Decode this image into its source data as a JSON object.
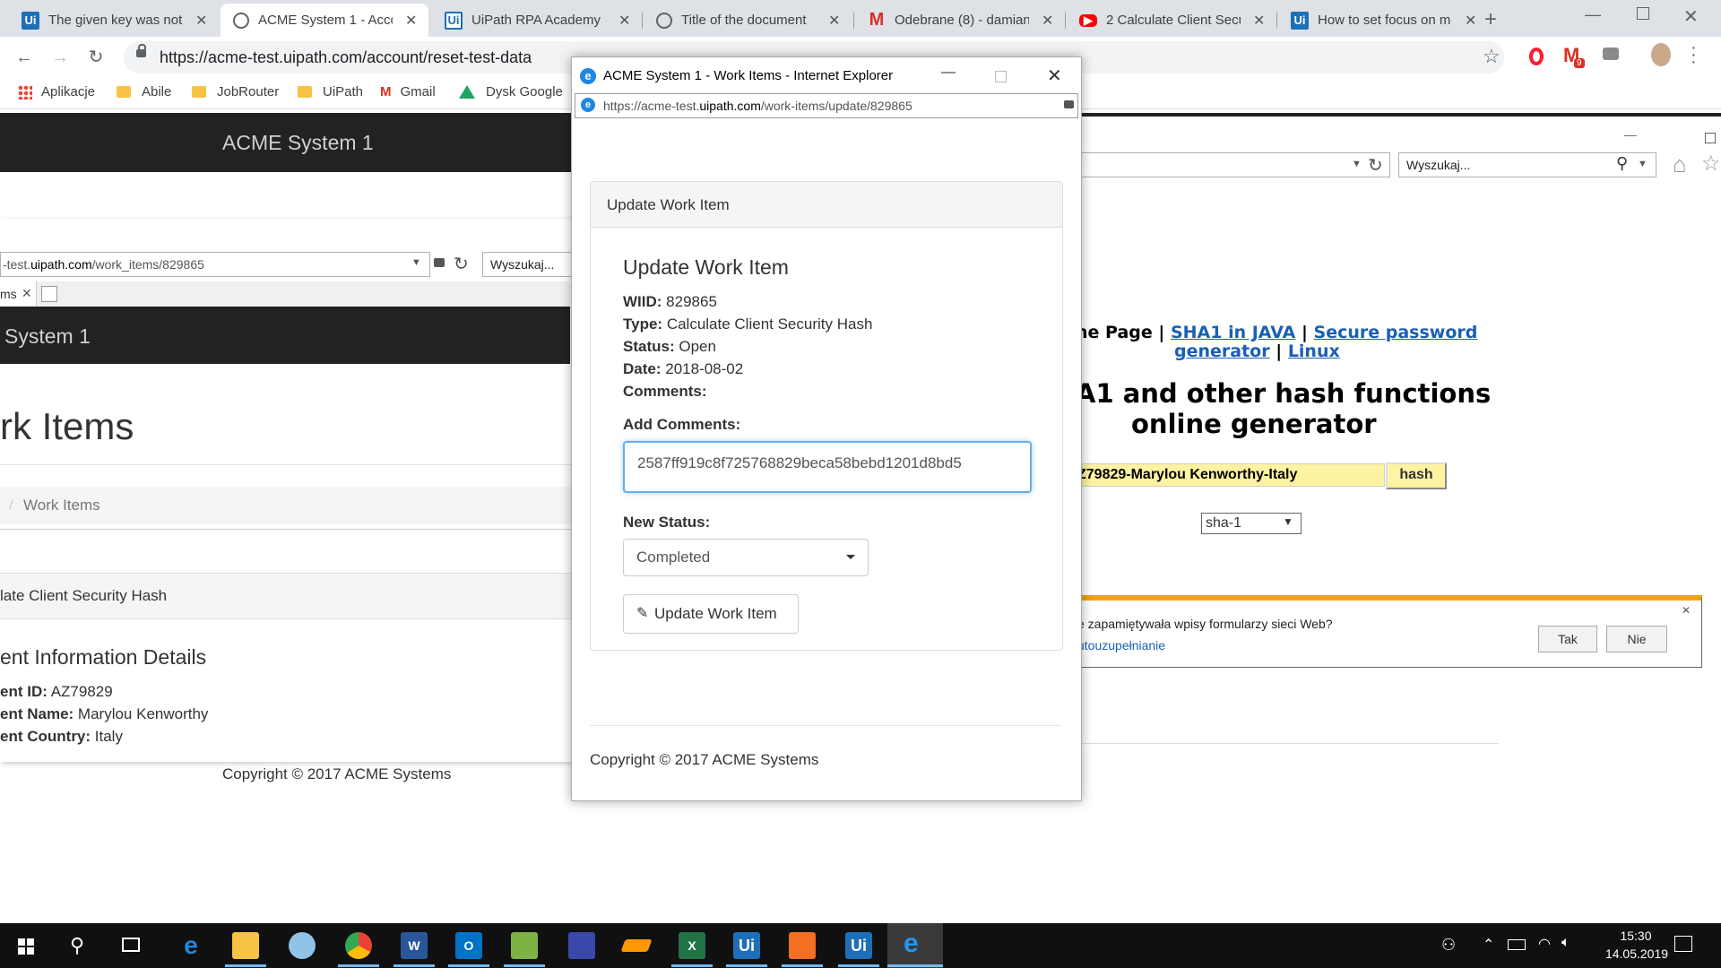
{
  "browser": {
    "tabs": [
      {
        "title": "The given key was not p",
        "icon": "uipath-icon"
      },
      {
        "title": "ACME System 1 - Accou",
        "icon": "globe-icon",
        "active": true
      },
      {
        "title": "UiPath RPA Academy",
        "icon": "uipath-icon"
      },
      {
        "title": "Title of the document",
        "icon": "globe-icon"
      },
      {
        "title": "Odebrane (8) - damian",
        "icon": "gmail-icon"
      },
      {
        "title": "2 Calculate Client Secu",
        "icon": "youtube-icon"
      },
      {
        "title": "How to set focus on m",
        "icon": "uipath-icon"
      }
    ],
    "url": "https://acme-test.uipath.com/account/reset-test-data",
    "gmail_badge": "9",
    "bookmarks": [
      "Aplikacje",
      "Abile",
      "JobRouter",
      "UiPath",
      "Gmail",
      "Dysk Google"
    ]
  },
  "background_left": {
    "header_title": "ACME System 1",
    "ie_url_prefix": "-test.",
    "ie_url_domain": "uipath.com",
    "ie_url_path": "/work_items/829865",
    "ie_search_placeholder": "Wyszukaj...",
    "ie_tab_label": "ms",
    "inner_header_title": "System 1",
    "page_heading": "rk Items",
    "breadcrumb_sep": "/",
    "breadcrumb": "Work Items",
    "panel_title": "late Client Security Hash",
    "section_title": "ent Information Details",
    "client_id_label": "ent ID:",
    "client_id": "AZ79829",
    "client_name_label": "ent Name:",
    "client_name": "Marylou Kenworthy",
    "client_country_label": "ent Country:",
    "client_country": "Italy",
    "copyright": "Copyright © 2017 ACME Systems"
  },
  "background_right": {
    "search_placeholder": "Wyszukaj...",
    "nav_prefix": "ne Page |",
    "link_sha1_java": "SHA1 in JAVA",
    "nav_sep": "|",
    "link_secure_1": "Secure password",
    "link_secure_2": "generator",
    "link_linux": "Linux",
    "heading_1": "A1 and other hash functions",
    "heading_2": "online generator",
    "hash_input": "Z79829-Marylou Kenworthy-Italy",
    "hash_button": "hash",
    "algorithm": "sha-1",
    "autocomplete_prompt": "e zapamiętywała wpisy formularzy sieci Web?",
    "autocomplete_link": "utouzupełnianie",
    "yes_button": "Tak",
    "no_button": "Nie"
  },
  "dialog": {
    "window_title": "ACME System 1 - Work Items - Internet Explorer",
    "url_prefix": "https://acme-test.",
    "url_domain": "uipath.com",
    "url_path": "/work-items/update/829865",
    "card_header": "Update Work Item",
    "heading": "Update Work Item",
    "wiid_label": "WIID:",
    "wiid": "829865",
    "type_label": "Type:",
    "type": "Calculate Client Security Hash",
    "status_label": "Status:",
    "status": "Open",
    "date_label": "Date:",
    "date": "2018-08-02",
    "comments_label": "Comments:",
    "add_comments_label": "Add Comments:",
    "comment_value": "2587ff919c8f725768829beca58bebd1201d8bd5",
    "new_status_label": "New Status:",
    "new_status_value": "Completed",
    "update_button": "Update Work Item",
    "copyright": "Copyright © 2017 ACME Systems"
  },
  "taskbar": {
    "time": "15:30",
    "date": "14.05.2019",
    "apps": [
      "edge",
      "file-explorer",
      "paint",
      "chrome",
      "word",
      "outlook",
      "notepad-plus",
      "save",
      "sublime",
      "excel",
      "uipath-studio",
      "orchestrator",
      "uipath-robot",
      "internet-explorer"
    ]
  },
  "colors": {
    "acme_header": "#222222",
    "focus_blue": "#66afe9",
    "link_blue": "#1a5fb4",
    "hash_yellow": "#fdf3a3",
    "taskbar": "#101010"
  }
}
